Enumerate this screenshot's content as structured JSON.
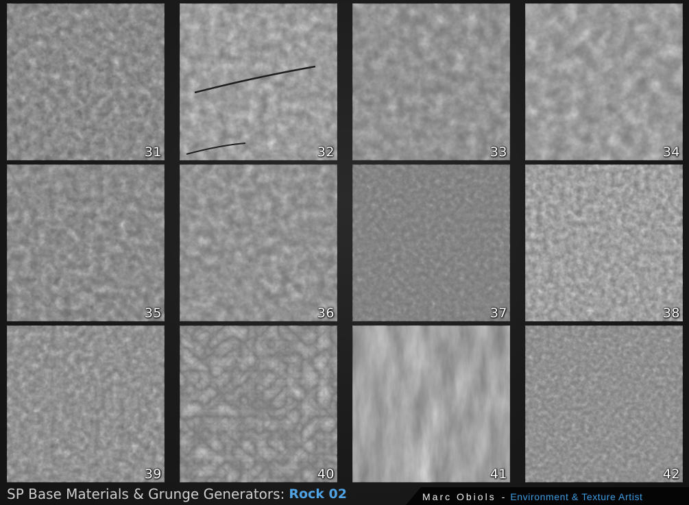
{
  "tiles": [
    {
      "label": "31"
    },
    {
      "label": "32"
    },
    {
      "label": "33"
    },
    {
      "label": "34"
    },
    {
      "label": "35"
    },
    {
      "label": "36"
    },
    {
      "label": "37"
    },
    {
      "label": "38"
    },
    {
      "label": "39"
    },
    {
      "label": "40"
    },
    {
      "label": "41"
    },
    {
      "label": "42"
    }
  ],
  "footer": {
    "title_prefix": "SP Base Materials & Grunge Generators:",
    "title_accent": "Rock 02",
    "author": "Marc Obiols",
    "separator": "-",
    "role": "Environment & Texture Artist"
  },
  "colors": {
    "accent": "#4fa2e3",
    "credit_role": "#3d9be0",
    "background": "#1b1b1b"
  }
}
